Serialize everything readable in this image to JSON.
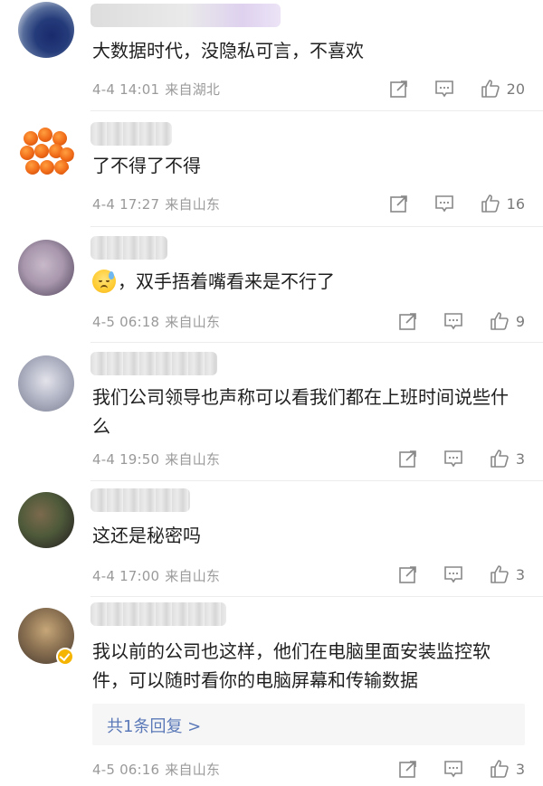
{
  "comments": [
    {
      "text": "大数据时代，没隐私可言，不喜欢",
      "date": "4-4 14:01",
      "location": "来自湖北",
      "likes": "20"
    },
    {
      "text": "了不得了不得",
      "date": "4-4 17:27",
      "location": "来自山东",
      "likes": "16"
    },
    {
      "text": "，双手捂着嘴看来是不行了",
      "date": "4-5 06:18",
      "location": "来自山东",
      "likes": "9"
    },
    {
      "text": "我们公司领导也声称可以看我们都在上班时间说些什么",
      "date": "4-4 19:50",
      "location": "来自山东",
      "likes": "3"
    },
    {
      "text": "这还是秘密吗",
      "date": "4-4 17:00",
      "location": "来自山东",
      "likes": "3"
    },
    {
      "text": "我以前的公司也这样，他们在电脑里面安装监控软件，可以随时看你的电脑屏幕和传输数据",
      "date": "4-5 06:16",
      "location": "来自山东",
      "likes": "3",
      "reply_link": "共1条回复 >"
    }
  ],
  "icons": {
    "share": "share-icon",
    "comment": "comment-icon",
    "like": "thumbs-up-icon",
    "emoji": "sweat-smile-emoji-icon",
    "verified": "verified-badge-icon"
  },
  "colors": {
    "link": "#5b79b8",
    "meta": "#9a9a9a",
    "verified": "#f5b400"
  }
}
